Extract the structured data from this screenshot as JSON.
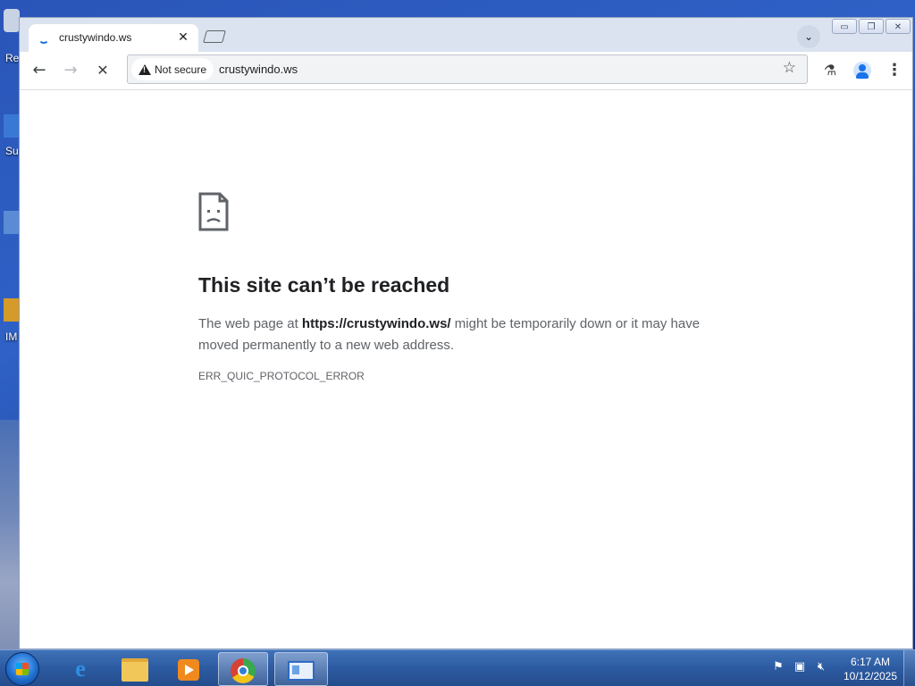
{
  "desktop": {
    "icons": [
      {
        "label": "Re",
        "icon": "recycle-bin-icon"
      },
      {
        "label": "Su",
        "icon": "app-icon"
      },
      {
        "label": "",
        "icon": "app-icon"
      },
      {
        "label": "IM",
        "icon": "app-icon"
      }
    ]
  },
  "browser": {
    "tab": {
      "title": "crustywindo.ws",
      "icon": "loading-spinner-icon"
    },
    "window_controls": {
      "minimize": "▭",
      "maximize": "❐",
      "close": "✕"
    },
    "tab_search_icon": "chevron-down-icon",
    "toolbar": {
      "security_chip": "Not secure",
      "url": "crustywindo.ws",
      "icons": [
        "back-icon",
        "forward-icon",
        "stop-icon",
        "warning-icon",
        "star-icon",
        "labs-icon",
        "profile-icon",
        "menu-icon"
      ]
    },
    "error_page": {
      "icon": "sad-page-icon",
      "title": "This site can’t be reached",
      "message_prefix": "The web page at ",
      "message_url": "https://crustywindo.ws/",
      "message_suffix": " might be temporarily down or it may have moved permanently to a new web address.",
      "error_code": "ERR_QUIC_PROTOCOL_ERROR"
    }
  },
  "taskbar": {
    "apps": [
      {
        "name": "internet-explorer",
        "icon": "ie-icon"
      },
      {
        "name": "file-explorer",
        "icon": "folder-icon"
      },
      {
        "name": "media-player",
        "icon": "media-player-icon"
      },
      {
        "name": "chrome",
        "icon": "chrome-icon"
      },
      {
        "name": "control-panel",
        "icon": "card-icon"
      }
    ],
    "tray_icons": [
      "flag-icon",
      "network-icon",
      "volume-muted-icon"
    ],
    "clock": {
      "time": "6:17 AM",
      "date": "10/12/2025"
    }
  }
}
